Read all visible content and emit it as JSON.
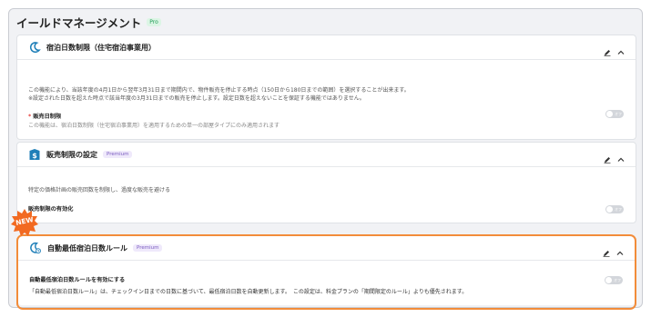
{
  "page": {
    "title": "イールドマネージメント",
    "badge": "Pro"
  },
  "cards": [
    {
      "title": "宿泊日数制限（住宅宿泊事業用）",
      "icon": "moon-icon",
      "description": [
        "この機能により、当該年度の4月1日から翌年3月31日まで期間内で、物件販売を停止する時点（150日から180日までの範囲）を選択することが出来ます。",
        "※設定された日数を超えた時点で該当年度の3月31日までの販売を停止します。設定日数を超えないことを保証する機能ではありません。"
      ],
      "setting_label": "販売日制限",
      "setting_required": "*",
      "setting_note": "この機能は、宿泊日数制限（住宅宿泊事業用）を適用するための単一の部屋タイプにのみ適用されます",
      "toggle_text": "オフ"
    },
    {
      "title": "販売制限の設定",
      "badge": "Premium",
      "icon": "dollar-sign-icon",
      "description": "特定の価格計画の販売回数を制限し、過度な販売を避ける",
      "setting_label": "販売制限の有効化",
      "toggle_text": "オフ"
    },
    {
      "title": "自動最低宿泊日数ルール",
      "badge": "Premium",
      "icon": "moon-clock-icon",
      "new_badge": "NEW",
      "setting_label": "自動最低宿泊日数ルールを有効にする",
      "description": "「自動最低宿泊日数ルール」は、チェックイン日までの日数に基づいて、最低宿泊日数を自動更新します。　この設定は、料金プランの「期間限定のルール」よりも優先されます。",
      "toggle_text": "オフ"
    }
  ],
  "colors": {
    "accent": "#f28c3a",
    "icon_blue": "#1f7fb8",
    "toggle_off": "#d3d6db"
  }
}
